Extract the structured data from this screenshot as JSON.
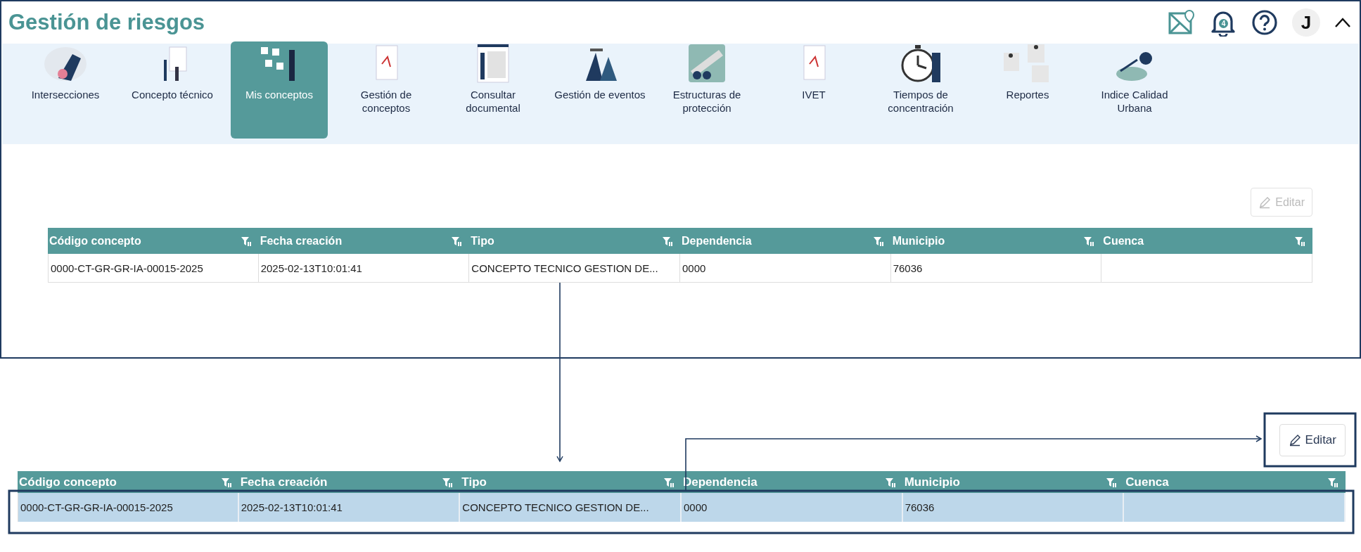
{
  "header": {
    "title": "Gestión de riesgos",
    "notification_count": "4",
    "avatar_letter": "J"
  },
  "nav": {
    "items": [
      {
        "label": "Intersecciones",
        "selected": false
      },
      {
        "label": "Concepto técnico",
        "selected": false
      },
      {
        "label": "Mis conceptos",
        "selected": true
      },
      {
        "label": "Gestión de conceptos",
        "selected": false
      },
      {
        "label": "Consultar documental",
        "selected": false
      },
      {
        "label": "Gestión de eventos",
        "selected": false
      },
      {
        "label": "Estructuras de protección",
        "selected": false
      },
      {
        "label": "IVET",
        "selected": false
      },
      {
        "label": "Tiempos de concentración",
        "selected": false
      },
      {
        "label": "Reportes",
        "selected": false
      },
      {
        "label": "Indice Calidad Urbana",
        "selected": false
      }
    ]
  },
  "tables": [
    {
      "edit_button": {
        "label": "Editar",
        "disabled": true
      },
      "columns": [
        "Código concepto",
        "Fecha creación",
        "Tipo",
        "Dependencia",
        "Municipio",
        "Cuenca"
      ],
      "rows": [
        {
          "selected": false,
          "cells": [
            "0000-CT-GR-GR-IA-00015-2025",
            "2025-02-13T10:01:41",
            "CONCEPTO TECNICO GESTION DE...",
            "0000",
            "76036",
            ""
          ]
        }
      ]
    },
    {
      "edit_button": {
        "label": "Editar",
        "disabled": false
      },
      "columns": [
        "Código concepto",
        "Fecha creación",
        "Tipo",
        "Dependencia",
        "Municipio",
        "Cuenca"
      ],
      "rows": [
        {
          "selected": true,
          "cells": [
            "0000-CT-GR-GR-IA-00015-2025",
            "2025-02-13T10:01:41",
            "CONCEPTO TECNICO GESTION DE...",
            "0000",
            "76036",
            ""
          ]
        }
      ]
    }
  ]
}
